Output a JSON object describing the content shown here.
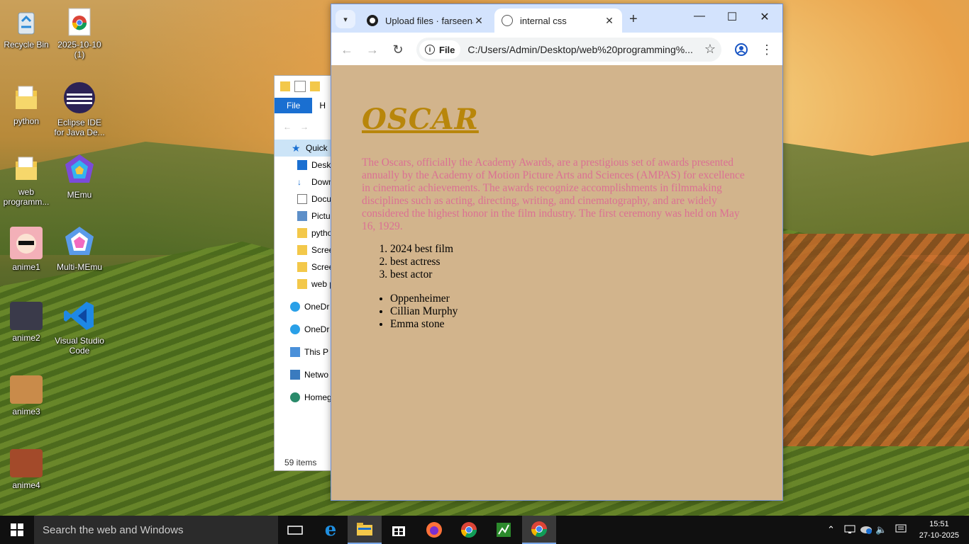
{
  "desktop": {
    "icons": [
      {
        "label": "Recycle Bin"
      },
      {
        "label": "2025-10-10 (1)"
      },
      {
        "label": "python"
      },
      {
        "label": "Eclipse IDE for Java De..."
      },
      {
        "label": "web programm..."
      },
      {
        "label": "MEmu"
      },
      {
        "label": "anime1"
      },
      {
        "label": "Multi-MEmu"
      },
      {
        "label": "anime2"
      },
      {
        "label": "Visual Studio Code"
      },
      {
        "label": "anime3"
      },
      {
        "label": "anime4"
      }
    ]
  },
  "explorer": {
    "ribbon": {
      "file": "File",
      "home": "H"
    },
    "nav": [
      {
        "label": "Quick",
        "icon": "star-icon"
      },
      {
        "label": "Deskt",
        "icon": "desktop-icon"
      },
      {
        "label": "Down",
        "icon": "download-icon"
      },
      {
        "label": "Docu",
        "icon": "document-icon"
      },
      {
        "label": "Pictur",
        "icon": "picture-icon"
      },
      {
        "label": "pytho",
        "icon": "folder-icon"
      },
      {
        "label": "Scree",
        "icon": "folder-icon"
      },
      {
        "label": "Scree",
        "icon": "folder-icon"
      },
      {
        "label": "web p",
        "icon": "folder-icon"
      },
      {
        "label": "OneDr",
        "icon": "cloud-icon"
      },
      {
        "label": "OneDr",
        "icon": "cloud-icon"
      },
      {
        "label": "This P",
        "icon": "pc-icon"
      },
      {
        "label": "Netwo",
        "icon": "network-icon"
      },
      {
        "label": "Homeg",
        "icon": "homegroup-icon"
      }
    ],
    "status": "59 items"
  },
  "browser": {
    "tabs": [
      {
        "title": "Upload files · farseena",
        "icon": "github-icon"
      },
      {
        "title": "internal css",
        "icon": "globe-icon"
      }
    ],
    "new_tab": "+",
    "controls": {
      "minimize": "—",
      "maximize": "☐",
      "close": "✕"
    },
    "toolbar": {
      "back": "←",
      "forward": "→",
      "reload": "↻",
      "chip": "File",
      "url": "C:/Users/Admin/Desktop/web%20programming%...",
      "star": "☆"
    }
  },
  "page": {
    "heading": "OSCAR",
    "paragraph": "The Oscars, officially the Academy Awards, are a prestigious set of awards presented annually by the Academy of Motion Picture Arts and Sciences (AMPAS) for excellence in cinematic achievements. The awards recognize accomplishments in filmmaking disciplines such as acting, directing, writing, and cinematography, and are widely considered the highest honor in the film industry. The first ceremony was held on May 16, 1929.",
    "ordered": [
      "2024 best film",
      "best actress",
      "best actor"
    ],
    "unordered": [
      "Oppenheimer",
      "Cillian Murphy",
      "Emma stone"
    ]
  },
  "taskbar": {
    "search_placeholder": "Search the web and Windows",
    "time": "15:51",
    "date": "27-10-2025"
  },
  "colors": {
    "page_bg": "#d2b48c",
    "heading": "#b8860b",
    "paragraph": "#db7093"
  }
}
